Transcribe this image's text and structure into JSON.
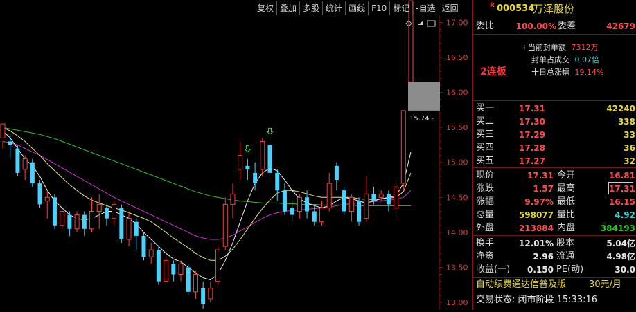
{
  "toolbar": {
    "items": [
      "复权",
      "叠加",
      "多股",
      "统计",
      "画线",
      "F10",
      "标记",
      "-自选",
      "返回"
    ]
  },
  "chart_data": {
    "type": "candlestick",
    "ylim": [
      13.0,
      17.4
    ],
    "y_ticks": [
      "17.00",
      "16.50",
      "16.00",
      "15.50",
      "15.00",
      "14.50",
      "14.00",
      "13.50",
      "13.00"
    ],
    "y_tick_values": [
      17.0,
      16.5,
      16.0,
      15.5,
      15.0,
      14.5,
      14.0,
      13.5,
      13.0
    ],
    "low_label": "12.91",
    "price_marker": "15.74",
    "candles": [
      [
        15.35,
        15.55,
        15.3,
        15.2
      ],
      [
        15.3,
        15.25,
        15.4,
        15.05
      ],
      [
        15.2,
        14.85,
        15.25,
        14.8
      ],
      [
        14.9,
        15.05,
        15.1,
        14.75
      ],
      [
        15.0,
        14.7,
        15.05,
        14.65
      ],
      [
        14.7,
        14.4,
        14.75,
        14.35
      ],
      [
        14.45,
        14.5,
        14.6,
        14.2
      ],
      [
        14.5,
        14.1,
        14.55,
        14.05
      ],
      [
        14.1,
        14.3,
        14.35,
        14.05
      ],
      [
        14.25,
        14.05,
        14.3,
        13.95
      ],
      [
        14.05,
        14.25,
        14.3,
        14.0
      ],
      [
        14.25,
        14.05,
        14.3,
        13.95
      ],
      [
        14.05,
        14.3,
        14.5,
        14.0
      ],
      [
        14.3,
        14.4,
        14.55,
        14.05
      ],
      [
        14.35,
        14.2,
        14.4,
        14.1
      ],
      [
        14.2,
        14.4,
        14.45,
        14.1
      ],
      [
        14.35,
        13.9,
        14.4,
        13.85
      ],
      [
        13.9,
        14.2,
        14.3,
        13.8
      ],
      [
        14.15,
        13.95,
        14.2,
        13.75
      ],
      [
        13.95,
        13.65,
        14.0,
        13.6
      ],
      [
        13.65,
        13.75,
        13.85,
        13.55
      ],
      [
        13.75,
        13.3,
        13.8,
        13.25
      ],
      [
        13.3,
        13.6,
        13.75,
        13.25
      ],
      [
        13.55,
        13.4,
        13.6,
        13.3
      ],
      [
        13.4,
        13.55,
        13.6,
        13.3
      ],
      [
        13.5,
        13.15,
        13.55,
        13.1
      ],
      [
        13.15,
        13.4,
        13.45,
        13.05
      ],
      [
        13.2,
        12.98,
        13.3,
        12.91
      ],
      [
        13.05,
        13.2,
        13.3,
        13.0
      ],
      [
        13.3,
        13.75,
        13.8,
        13.25
      ],
      [
        13.8,
        14.4,
        14.5,
        13.75
      ],
      [
        14.4,
        14.55,
        14.7,
        14.2
      ],
      [
        14.9,
        15.1,
        15.3,
        14.75
      ],
      [
        14.95,
        14.9,
        15.05,
        14.75
      ],
      [
        14.85,
        14.7,
        15.0,
        14.6
      ],
      [
        14.9,
        15.3,
        15.35,
        14.8
      ],
      [
        15.25,
        14.85,
        15.3,
        14.75
      ],
      [
        14.85,
        14.6,
        14.9,
        14.45
      ],
      [
        14.6,
        14.3,
        14.7,
        14.25
      ],
      [
        14.35,
        14.25,
        14.45,
        14.15
      ],
      [
        14.3,
        14.5,
        14.55,
        14.2
      ],
      [
        14.5,
        14.3,
        14.6,
        14.2
      ],
      [
        14.3,
        14.15,
        14.4,
        14.1
      ],
      [
        14.15,
        14.35,
        14.45,
        14.1
      ],
      [
        14.35,
        14.7,
        14.85,
        14.3
      ],
      [
        14.95,
        14.75,
        15.0,
        14.6
      ],
      [
        14.6,
        14.3,
        14.65,
        14.25
      ],
      [
        14.3,
        14.5,
        14.55,
        14.15
      ],
      [
        14.45,
        14.15,
        14.5,
        14.1
      ],
      [
        14.2,
        14.55,
        14.8,
        14.15
      ],
      [
        14.55,
        14.45,
        14.65,
        14.4
      ],
      [
        14.5,
        14.55,
        14.6,
        14.45
      ],
      [
        14.55,
        14.4,
        14.6,
        14.3
      ],
      [
        14.35,
        14.65,
        14.75,
        14.2
      ],
      [
        14.7,
        15.74,
        15.74,
        14.6
      ],
      [
        16.15,
        17.31,
        17.31,
        16.15
      ]
    ],
    "ma_white": [
      15.45,
      15.35,
      15.2,
      15.05,
      14.95,
      14.8,
      14.6,
      14.45,
      14.35,
      14.25,
      14.2,
      14.18,
      14.2,
      14.25,
      14.3,
      14.3,
      14.25,
      14.2,
      14.12,
      14.0,
      13.9,
      13.8,
      13.7,
      13.62,
      13.58,
      13.5,
      13.42,
      13.35,
      13.32,
      13.4,
      13.6,
      13.85,
      14.15,
      14.45,
      14.7,
      14.85,
      14.92,
      14.88,
      14.75,
      14.6,
      14.48,
      14.42,
      14.38,
      14.35,
      14.38,
      14.45,
      14.5,
      14.48,
      14.45,
      14.42,
      14.45,
      14.48,
      14.5,
      14.52,
      14.7,
      15.15
    ],
    "ma_yellow": [
      15.5,
      15.45,
      15.38,
      15.3,
      15.2,
      15.1,
      14.98,
      14.88,
      14.78,
      14.68,
      14.6,
      14.52,
      14.46,
      14.42,
      14.38,
      14.35,
      14.32,
      14.28,
      14.24,
      14.2,
      14.15,
      14.08,
      14.0,
      13.92,
      13.85,
      13.78,
      13.7,
      13.64,
      13.6,
      13.6,
      13.66,
      13.76,
      13.9,
      14.05,
      14.2,
      14.34,
      14.46,
      14.56,
      14.6,
      14.6,
      14.58,
      14.55,
      14.52,
      14.5,
      14.5,
      14.5,
      14.5,
      14.5,
      14.48,
      14.47,
      14.47,
      14.48,
      14.49,
      14.5,
      14.58,
      14.85
    ],
    "ma_magenta": [
      15.3,
      15.28,
      15.25,
      15.2,
      15.15,
      15.1,
      15.04,
      14.98,
      14.92,
      14.86,
      14.8,
      14.74,
      14.68,
      14.62,
      14.56,
      14.5,
      14.45,
      14.4,
      14.35,
      14.3,
      14.25,
      14.2,
      14.15,
      14.1,
      14.05,
      14.0,
      13.95,
      13.92,
      13.9,
      13.9,
      13.92,
      13.96,
      14.02,
      14.08,
      14.14,
      14.2,
      14.25,
      14.28,
      14.3,
      14.31,
      14.32,
      14.33,
      14.34,
      14.35,
      14.36,
      14.38,
      14.4,
      14.41,
      14.42,
      14.43,
      14.44,
      14.45,
      14.46,
      14.47,
      14.5,
      14.6
    ],
    "ma_green": [
      15.5,
      15.48,
      15.46,
      15.44,
      15.42,
      15.4,
      15.37,
      15.34,
      15.3,
      15.26,
      15.22,
      15.18,
      15.14,
      15.1,
      15.06,
      15.02,
      14.98,
      14.94,
      14.9,
      14.86,
      14.82,
      14.78,
      14.74,
      14.7,
      14.66,
      14.62,
      14.58,
      14.55,
      14.52,
      14.5,
      14.48,
      14.46,
      14.45,
      14.44,
      14.43,
      14.42,
      14.42,
      14.42,
      14.41,
      14.41,
      14.4,
      14.4,
      14.4,
      14.39,
      14.39,
      14.39,
      14.39,
      14.39,
      14.38,
      14.38,
      14.38,
      14.38,
      14.38,
      14.38,
      14.38,
      14.38
    ]
  },
  "panel": {
    "header_r": "R",
    "code": "000534",
    "name": "万泽股份",
    "weibi_label": "委比",
    "weibi_value": "100.00%",
    "weicha_label": "委差",
    "weicha_value": "42679",
    "lianban": "2连板",
    "seal_amount_label": "当前封单额",
    "seal_amount_value": "7312万",
    "seal_ratio_label": "封单占成交",
    "seal_ratio_value": "0.07倍",
    "ten_day_label": "十日总涨幅",
    "ten_day_value": "19.14%",
    "bids": [
      {
        "label": "买一",
        "price": "17.31",
        "vol": "42240"
      },
      {
        "label": "买二",
        "price": "17.30",
        "vol": "338"
      },
      {
        "label": "买三",
        "price": "17.29",
        "vol": "33"
      },
      {
        "label": "买四",
        "price": "17.28",
        "vol": "36"
      },
      {
        "label": "买五",
        "price": "17.27",
        "vol": "32"
      }
    ],
    "quote": [
      {
        "l1": "现价",
        "v1": "17.31",
        "l2": "今开",
        "v2": "16.81"
      },
      {
        "l1": "涨跌",
        "v1": "1.57",
        "l2": "最高",
        "v2": "17.31"
      },
      {
        "l1": "涨幅",
        "v1": "9.97%",
        "l2": "最低",
        "v2": "16.15"
      },
      {
        "l1": "总量",
        "v1": "598077",
        "l2": "量比",
        "v2": "4.92"
      },
      {
        "l1": "外盘",
        "v1": "213884",
        "l2": "内盘",
        "v2": "384193"
      }
    ],
    "fund": [
      {
        "l1": "换手",
        "v1": "12.01%",
        "l2": "股本",
        "v2": "5.04亿"
      },
      {
        "l1": "净资",
        "v1": "2.96",
        "l2": "流通",
        "v2": "4.98亿"
      },
      {
        "l1": "收益(一)",
        "v1": "0.150",
        "l2": "PE(动)",
        "v2": "30.0"
      }
    ],
    "promo": "自动续费通达信普及版",
    "promo_price": "30元/月",
    "status": "交易状态: 闭市阶段 15:33:16"
  }
}
